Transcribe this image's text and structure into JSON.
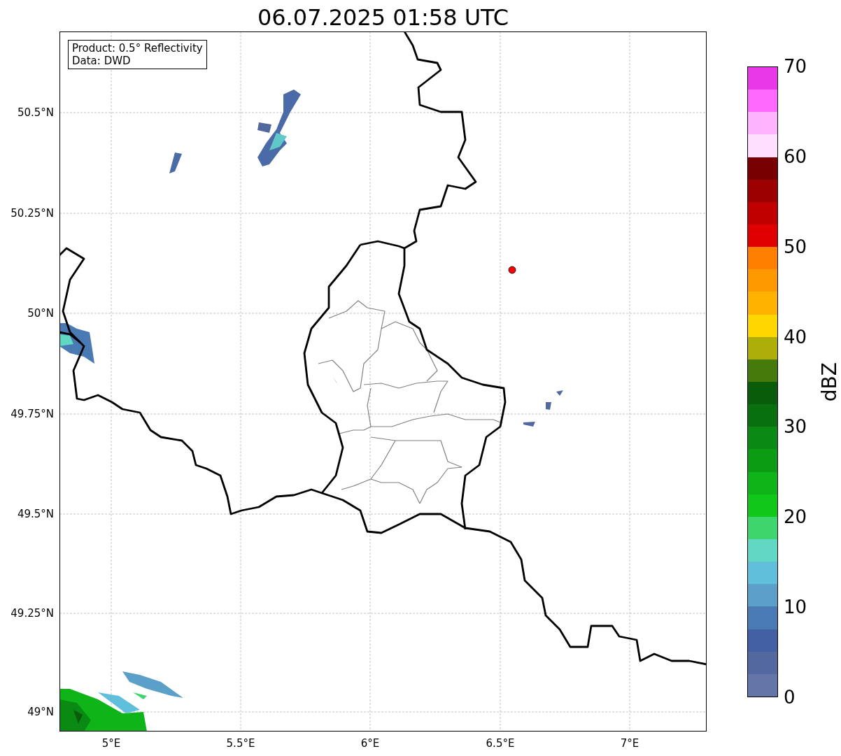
{
  "title": "06.07.2025 01:58 UTC",
  "map": {
    "info_box": [
      "Product: 0.5° Reflectivity",
      "Data: DWD"
    ],
    "x_ticks": [
      "5°E",
      "5.5°E",
      "6°E",
      "6.5°E",
      "7°E"
    ],
    "y_ticks": [
      "50.5°N",
      "50.25°N",
      "50°N",
      "49.75°N",
      "49.5°N",
      "49.25°N",
      "49°N"
    ]
  },
  "colorbar": {
    "label": "dBZ",
    "ticks": [
      "70",
      "60",
      "50",
      "40",
      "30",
      "20",
      "10",
      "0"
    ],
    "segments": [
      {
        "color": "#6476a8"
      },
      {
        "color": "#5468a0"
      },
      {
        "color": "#4460a4"
      },
      {
        "color": "#4a7ab4"
      },
      {
        "color": "#5aa0c8"
      },
      {
        "color": "#60c0dc"
      },
      {
        "color": "#60d8c4"
      },
      {
        "color": "#3cd66c"
      },
      {
        "color": "#10c81a"
      },
      {
        "color": "#0eb418"
      },
      {
        "color": "#0c9c14"
      },
      {
        "color": "#0a8a12"
      },
      {
        "color": "#08700e"
      },
      {
        "color": "#085c0a"
      },
      {
        "color": "#467a0a"
      },
      {
        "color": "#aeae09"
      },
      {
        "color": "#ffd700"
      },
      {
        "color": "#ffb300"
      },
      {
        "color": "#ff9900"
      },
      {
        "color": "#ff7f00"
      },
      {
        "color": "#e00000"
      },
      {
        "color": "#c00000"
      },
      {
        "color": "#9c0000"
      },
      {
        "color": "#780000"
      },
      {
        "color": "#fee0fe"
      },
      {
        "color": "#feb3fe"
      },
      {
        "color": "#fe6afe"
      },
      {
        "color": "#e838e8"
      }
    ]
  }
}
